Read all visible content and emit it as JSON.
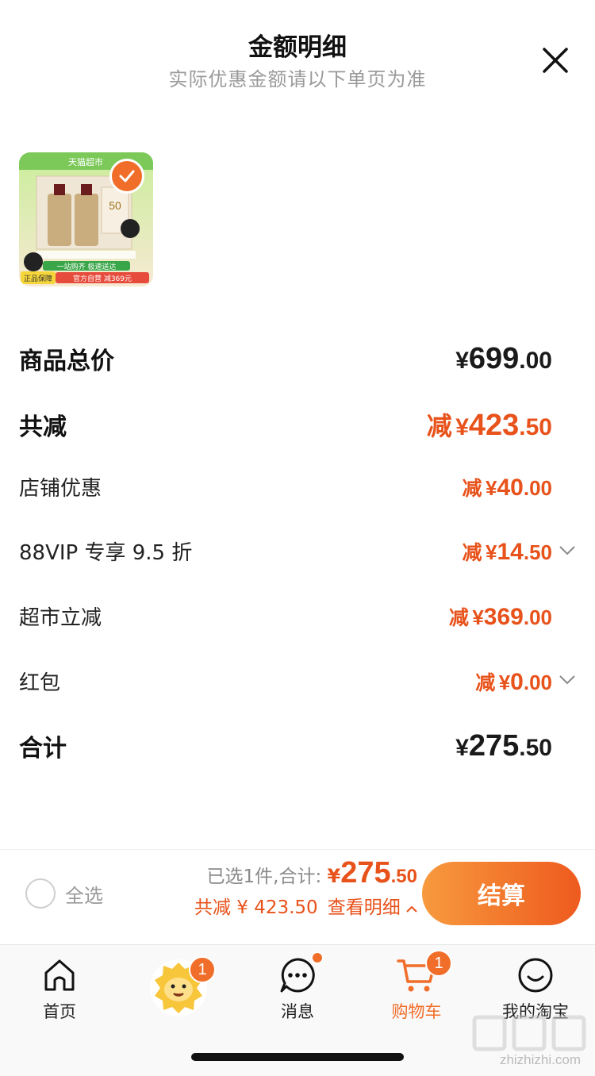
{
  "header": {
    "title": "金额明细",
    "subtitle": "实际优惠金额请以下单页为准"
  },
  "product": {
    "image_texts": {
      "store": "天猫超市",
      "gift_amount": "50",
      "banner1": "一站购齐 极速送达",
      "banner2": "官方自营 减369元",
      "guarantee": "正品保障"
    },
    "selected": true
  },
  "rows": [
    {
      "label": "商品总价",
      "prefix": "",
      "yen": "¥",
      "int": "699",
      "dec": ".00",
      "style": "total"
    },
    {
      "label": "共减",
      "prefix": "减",
      "yen": "¥",
      "int": "423",
      "dec": ".50",
      "style": "discount-total"
    },
    {
      "label": "店铺优惠",
      "prefix": "减",
      "yen": "¥",
      "int": "40",
      "dec": ".00",
      "style": "discount"
    },
    {
      "label": "88VIP 专享 9.5 折",
      "prefix": "减",
      "yen": "¥",
      "int": "14",
      "dec": ".50",
      "style": "discount",
      "expandable": true
    },
    {
      "label": "超市立减",
      "prefix": "减",
      "yen": "¥",
      "int": "369",
      "dec": ".00",
      "style": "discount"
    },
    {
      "label": "红包",
      "prefix": "减",
      "yen": "¥",
      "int": "0",
      "dec": ".00",
      "style": "discount",
      "expandable": true
    },
    {
      "label": "合计",
      "prefix": "",
      "yen": "¥",
      "int": "275",
      "dec": ".50",
      "style": "total"
    }
  ],
  "bottom_bar": {
    "select_all": "全选",
    "selected_text": "已选1件,合计:",
    "yen": "¥",
    "total_int": "275",
    "total_dec": ".50",
    "saved_text": "共减 ¥ 423.50",
    "detail_link": "查看明细",
    "checkout": "结算"
  },
  "tabbar": {
    "items": [
      {
        "label": "首页",
        "icon": "home-icon"
      },
      {
        "label": "",
        "icon": "mascot-icon",
        "badge": "1"
      },
      {
        "label": "消息",
        "icon": "message-icon",
        "dot": true
      },
      {
        "label": "购物车",
        "icon": "cart-icon",
        "badge": "1",
        "active": true
      },
      {
        "label": "我的淘宝",
        "icon": "profile-icon"
      }
    ]
  },
  "watermark": "zhizhizhi.com",
  "colors": {
    "accent": "#f06e2a",
    "discount": "#e8521b",
    "muted": "#9a9a9a"
  }
}
